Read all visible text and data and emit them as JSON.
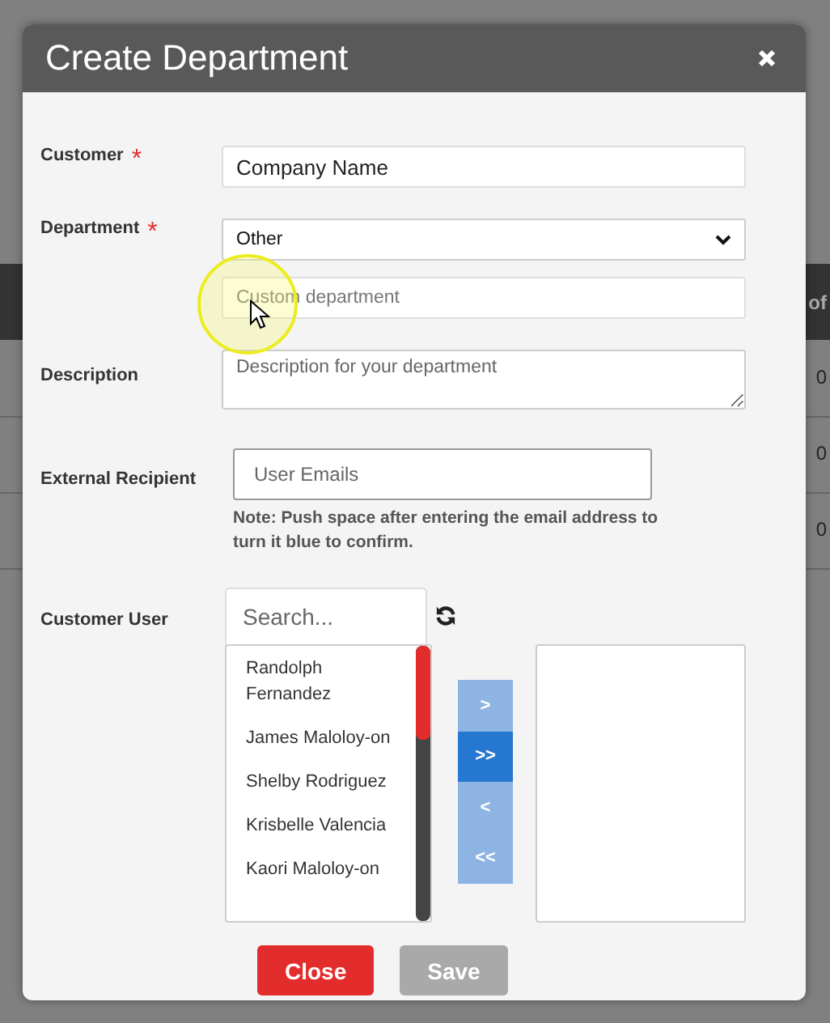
{
  "background_table": {
    "header_fragment": "of",
    "cell_fragments": [
      "0",
      "0",
      "0"
    ]
  },
  "dialog": {
    "title": "Create Department",
    "customer": {
      "label": "Customer",
      "required_mark": "*",
      "value": "Company Name"
    },
    "department": {
      "label": "Department",
      "required_mark": "*",
      "value": "Other"
    },
    "custom_department": {
      "placeholder": "Custom department"
    },
    "description": {
      "label": "Description",
      "placeholder": "Description for your department"
    },
    "external_recipient": {
      "label": "External Recipient",
      "placeholder": "User Emails",
      "note": "Note: Push space after entering the email address to turn it blue to confirm."
    },
    "customer_user": {
      "label": "Customer User",
      "search_placeholder": "Search...",
      "users": [
        "Randolph Fernandez",
        "James Maloloy-on",
        "Shelby Rodriguez",
        "Krisbelle Valencia",
        "Kaori Maloloy-on"
      ],
      "transfer_buttons": [
        {
          "symbol": ">",
          "selected": false
        },
        {
          "symbol": ">>",
          "selected": true
        },
        {
          "symbol": "<",
          "selected": false
        },
        {
          "symbol": "<<",
          "selected": false
        }
      ]
    },
    "buttons": [
      {
        "label": "Close",
        "kind": "danger",
        "disabled": false
      },
      {
        "label": "Save",
        "kind": "primary",
        "disabled": true
      }
    ]
  }
}
